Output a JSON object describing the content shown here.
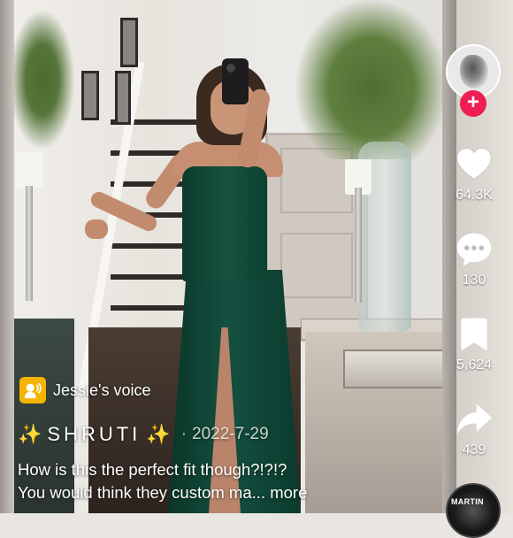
{
  "profile": {
    "follow_label": "+"
  },
  "actions": {
    "likes": "64.3K",
    "comments": "130",
    "saves": "5,624",
    "shares": "439"
  },
  "sound": {
    "label": "Jessie's voice",
    "badge_color": "#f5b400",
    "disc_label": "MARTIN"
  },
  "author": {
    "sparkle_left": "✨",
    "name": "SHRUTI",
    "sparkle_right": "✨",
    "separator": "·",
    "date": "2022-7-29"
  },
  "caption": {
    "line1": "How is this the perfect fit though?!?!?",
    "line2": "You would think they custom ma...",
    "more_label": "more"
  },
  "colors": {
    "follow": "#ee1d52",
    "text": "#ffffff",
    "sparkle": "#f7c948"
  },
  "icons": [
    "heart-icon",
    "comment-icon",
    "bookmark-icon",
    "share-icon",
    "voice-icon",
    "plus-icon",
    "music-disc-icon"
  ]
}
